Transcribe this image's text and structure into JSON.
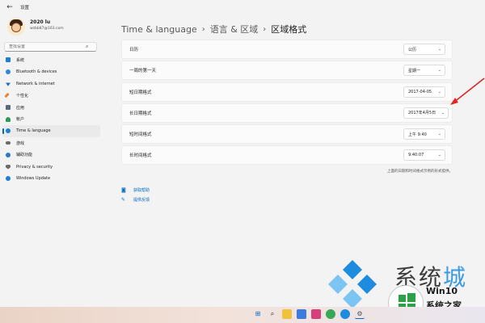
{
  "window": {
    "title": "设置"
  },
  "user": {
    "name": "2020 lu",
    "email": "wzbb87@163.com"
  },
  "search": {
    "placeholder": "查找设置"
  },
  "sidebar": {
    "items": [
      {
        "label": "系统",
        "icon": "monitor-icon",
        "color": "#1d7ed6",
        "active": false
      },
      {
        "label": "Bluetooth & devices",
        "icon": "bluetooth-icon",
        "color": "#2b88d8",
        "active": false
      },
      {
        "label": "Network & internet",
        "icon": "wifi-icon",
        "color": "#1f6fb8",
        "active": false
      },
      {
        "label": "个性化",
        "icon": "brush-icon",
        "color": "#e0842f",
        "active": false
      },
      {
        "label": "应用",
        "icon": "apps-icon",
        "color": "#586a7c",
        "active": false
      },
      {
        "label": "帐户",
        "icon": "person-icon",
        "color": "#2e9a5c",
        "active": false
      },
      {
        "label": "Time & language",
        "icon": "clock-globe-icon",
        "color": "#1d7ed6",
        "active": true
      },
      {
        "label": "游戏",
        "icon": "gamepad-icon",
        "color": "#6b6b6b",
        "active": false
      },
      {
        "label": "辅助功能",
        "icon": "accessibility-icon",
        "color": "#2d76c9",
        "active": false
      },
      {
        "label": "Privacy & security",
        "icon": "shield-icon",
        "color": "#6b6b6b",
        "active": false
      },
      {
        "label": "Windows Update",
        "icon": "update-icon",
        "color": "#1d7ed6",
        "active": false
      }
    ]
  },
  "breadcrumb": {
    "root": "Time & language",
    "middle": "语言 & 区域",
    "current": "区域格式"
  },
  "settings": {
    "rows": [
      {
        "label": "日历",
        "value": "公历"
      },
      {
        "label": "一周的第一天",
        "value": "星期一"
      },
      {
        "label": "短日期格式",
        "value": "2017-04-05"
      },
      {
        "label": "长日期格式",
        "value": "2017年4月5日"
      },
      {
        "label": "短时间格式",
        "value": "上午 9:40"
      },
      {
        "label": "长时间格式",
        "value": "9:40:07"
      }
    ],
    "note": "上面的日期和时间格式示例的形式提供。"
  },
  "help": {
    "get_help": "获取帮助",
    "feedback": "提供反馈"
  },
  "watermark": {
    "big_left": "系统",
    "big_right": "城",
    "title": "Win10",
    "subtitle": "系统之家"
  },
  "taskbar": {
    "icons": [
      "windows-start-icon",
      "search-icon",
      "file-explorer-icon",
      "file-manager-icon",
      "photos-icon",
      "chrome-icon",
      "edge-icon",
      "settings-icon"
    ]
  },
  "colors": {
    "accent": "#0067c0",
    "annotation_arrow": "#e02424",
    "watermark_green": "#2ba245",
    "watermark_blue": "#1d8be0"
  }
}
